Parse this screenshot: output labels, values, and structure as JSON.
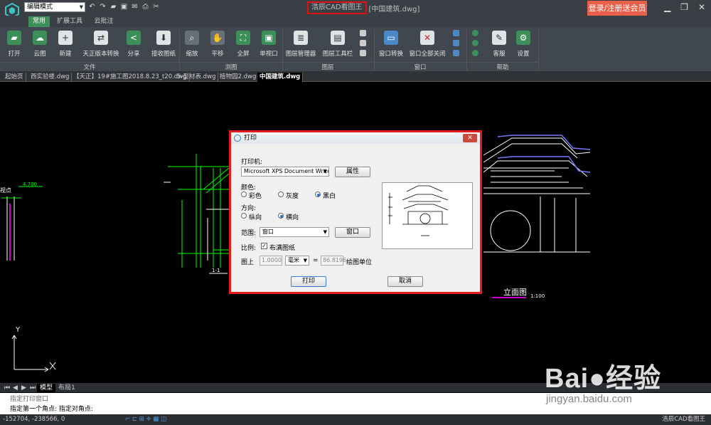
{
  "titlebar": {
    "mode_select": "编辑模式",
    "app_name": "浩辰CAD看图王",
    "doc_name": "[中国建筑.dwg]",
    "login_label": "登录/注册送会员",
    "qat_icons": [
      "undo-icon",
      "redo-icon",
      "open-icon",
      "save-icon",
      "email-icon",
      "print-icon",
      "cut-icon"
    ]
  },
  "ribbon": {
    "tabs": [
      "常用",
      "扩展工具",
      "云批注"
    ],
    "buttons": {
      "open": "打开",
      "cloud": "云图",
      "new": "新建",
      "convert": "天正版本转换",
      "share": "分享",
      "receive": "接收图纸",
      "zoom": "缩放",
      "pan": "平移",
      "fullscreen": "全屏",
      "single_view": "单视口",
      "layer_manager": "图层管理器",
      "layer_toolbar": "图层工具栏",
      "window_switch": "窗口转换",
      "close_all": "窗口全部关闭",
      "service": "客服",
      "settings": "设置"
    },
    "groups": {
      "file": "文件",
      "view": "浏图",
      "layer": "图层",
      "window": "窗口",
      "help": "帮助"
    }
  },
  "doc_tabs": [
    "起始页",
    "西实验楼.dwg",
    "【天正】19#施工图2018.8.23_t20.dwg",
    "5-型材表.dwg",
    "植物园2.dwg",
    "中国建筑.dwg"
  ],
  "canvas": {
    "elev_label": "立面图",
    "scale_label": "1:100",
    "section_label": "1-1",
    "left_label": "视点",
    "dim_label": "4.700",
    "axis_y": "Y",
    "axis_x": "X"
  },
  "dialog": {
    "title": "打印",
    "printer_label": "打印机:",
    "printer_value": "Microsoft XPS Document Writer",
    "properties_btn": "属性",
    "color_label": "颜色:",
    "color_options": [
      "彩色",
      "灰度",
      "黑白"
    ],
    "orientation_label": "方向:",
    "orientation_options": [
      "纵向",
      "横向"
    ],
    "range_label": "范围:",
    "range_value": "窗口",
    "window_btn": "窗口",
    "scale_label": "比例:",
    "fit_label": "布满图纸",
    "on_paper_label": "图上",
    "paper_value": "1.0000",
    "unit_value": "毫米",
    "equals": "=",
    "drawing_value": "86.8196",
    "drawing_units_label": "绘图单位",
    "print_btn": "打印",
    "cancel_btn": "取消",
    "close_glyph": "✕"
  },
  "layout_tabs": {
    "model": "模型",
    "layout1": "布局1",
    "nav": [
      "⏮",
      "◀",
      "▶",
      "⏭"
    ]
  },
  "command": {
    "line1": "指定打印窗口",
    "line2": "指定第一个角点: 指定对角点:"
  },
  "status": {
    "coords": "-152704, -238566, 0",
    "right_label": "浩辰CAD看图王"
  },
  "watermark": {
    "brand": "Bai●经验",
    "url": "jingyan.baidu.com"
  }
}
